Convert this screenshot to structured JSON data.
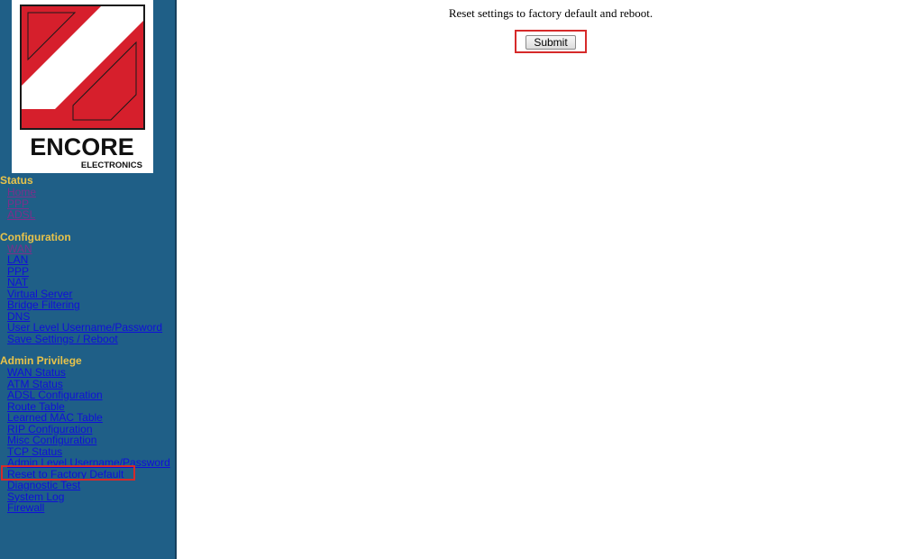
{
  "logo": {
    "brand_line1": "ENCORE",
    "brand_line2": "ELECTRONICS",
    "brand_color": "#d61f2c"
  },
  "sidebar": {
    "sections": [
      {
        "title": "Status",
        "items": [
          {
            "label": "Home",
            "visited": true
          },
          {
            "label": "PPP",
            "visited": true
          },
          {
            "label": "ADSL",
            "visited": true
          }
        ]
      },
      {
        "title": "Configuration",
        "items": [
          {
            "label": "WAN",
            "visited": true
          },
          {
            "label": "LAN",
            "visited": false
          },
          {
            "label": "PPP",
            "visited": false
          },
          {
            "label": "NAT",
            "visited": false
          },
          {
            "label": "Virtual Server",
            "visited": false
          },
          {
            "label": "Bridge Filtering",
            "visited": false
          },
          {
            "label": "DNS",
            "visited": false
          },
          {
            "label": "User Level Username/Password",
            "visited": false
          },
          {
            "label": "Save Settings / Reboot",
            "visited": false
          }
        ]
      },
      {
        "title": "Admin Privilege",
        "items": [
          {
            "label": "WAN Status",
            "visited": false
          },
          {
            "label": "ATM Status",
            "visited": false
          },
          {
            "label": "ADSL Configuration",
            "visited": false
          },
          {
            "label": "Route Table",
            "visited": false
          },
          {
            "label": "Learned MAC Table",
            "visited": false
          },
          {
            "label": "RIP Configuration",
            "visited": false
          },
          {
            "label": "Misc Configuration",
            "visited": false
          },
          {
            "label": "TCP Status",
            "visited": false
          },
          {
            "label": "Admin Level Username/Password",
            "visited": false
          },
          {
            "label": "Reset to Factory Default",
            "visited": false,
            "selected": true
          },
          {
            "label": "Diagnostic Test",
            "visited": false
          },
          {
            "label": "System Log",
            "visited": false
          },
          {
            "label": "Firewall",
            "visited": false
          }
        ]
      }
    ]
  },
  "main": {
    "message": "Reset settings to factory default and reboot.",
    "submit_label": "Submit"
  },
  "colors": {
    "sidebar_bg": "#1f5f87",
    "section_title": "#e8c34a",
    "link": "#1010d8",
    "visited_link": "#7b2f8c",
    "highlight": "#d62a2a"
  }
}
